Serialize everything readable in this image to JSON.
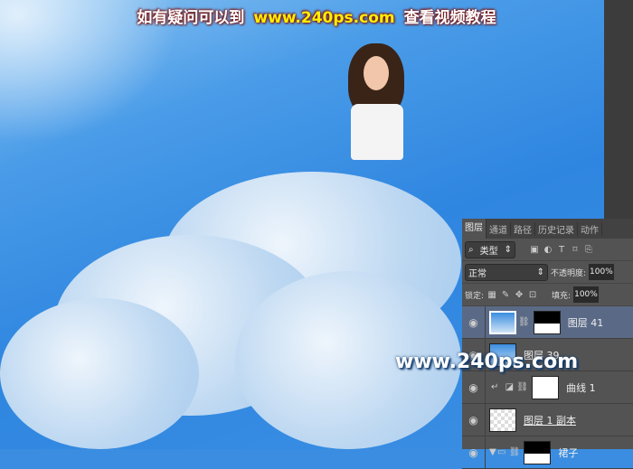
{
  "banner": {
    "left": "如有疑问可以到",
    "url": "www.240ps.com",
    "right": "查看视频教程"
  },
  "watermark": "www.240ps.com",
  "panel": {
    "tabs": [
      "图层",
      "通道",
      "路径",
      "历史记录",
      "动作"
    ],
    "filter_label": "类型",
    "blend_mode": "正常",
    "opacity_label": "不透明度:",
    "opacity_value": "100%",
    "lock_label": "锁定:",
    "fill_label": "填充:",
    "fill_value": "100%",
    "layers": [
      {
        "name": "图层 41",
        "selected": true
      },
      {
        "name": "图层 39"
      },
      {
        "name": "曲线 1"
      },
      {
        "name": "图层 1 副本"
      },
      {
        "name": "裙子"
      }
    ]
  }
}
